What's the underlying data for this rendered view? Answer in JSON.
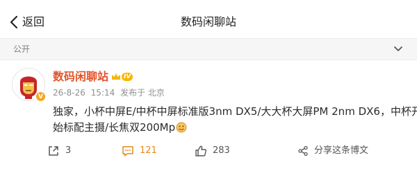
{
  "header": {
    "back_label": "返回",
    "title": "数码闲聊站"
  },
  "privacy": {
    "label": "公开"
  },
  "post": {
    "author": {
      "name": "数码闲聊站",
      "level": "IV"
    },
    "meta": {
      "date": "26-8-26",
      "time": "15:14",
      "location": "发布于 北京"
    },
    "content_lines": [
      "独家，小杯中屏E/中杯中屏标准版3nm DX5/大大杯大屏PM 2nm DX6，中杯开",
      "始标配主摄/长焦双200Mp"
    ],
    "actions": {
      "repost_count": "3",
      "comment_count": "121",
      "like_count": "283",
      "share_label": "分享这条博文"
    }
  },
  "colors": {
    "username": "#e2542a",
    "comment_accent": "#e48a1a",
    "verified_badge": "#f6a623"
  }
}
